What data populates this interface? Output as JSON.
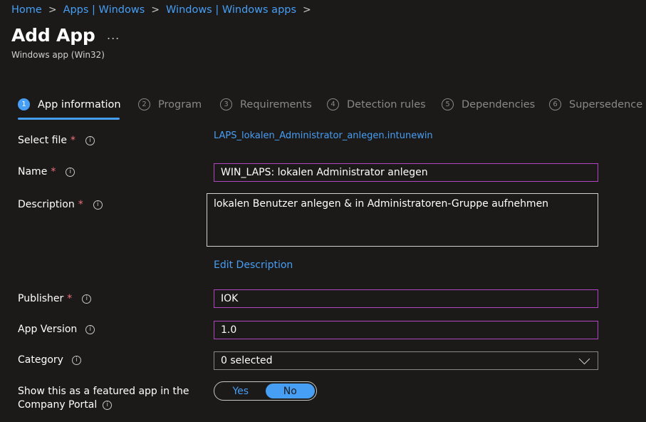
{
  "breadcrumb": {
    "items": [
      "Home",
      "Apps | Windows",
      "Windows | Windows apps"
    ],
    "separator": ">"
  },
  "header": {
    "title": "Add App",
    "more": "...",
    "subtitle": "Windows app (Win32)"
  },
  "steps": [
    {
      "num": "1",
      "label": "App information",
      "active": true
    },
    {
      "num": "2",
      "label": "Program"
    },
    {
      "num": "3",
      "label": "Requirements"
    },
    {
      "num": "4",
      "label": "Detection rules"
    },
    {
      "num": "5",
      "label": "Dependencies"
    },
    {
      "num": "6",
      "label": "Supersedence"
    }
  ],
  "form": {
    "select_file": {
      "label": "Select file",
      "required": "*",
      "value": "LAPS_lokalen_Administrator_anlegen.intunewin"
    },
    "name": {
      "label": "Name",
      "required": "*",
      "value": "WIN_LAPS: lokalen Administrator anlegen"
    },
    "description": {
      "label": "Description",
      "required": "*",
      "value": "lokalen Benutzer anlegen & in Administratoren-Gruppe aufnehmen",
      "edit_link": "Edit Description"
    },
    "publisher": {
      "label": "Publisher",
      "required": "*",
      "value": "IOK"
    },
    "app_version": {
      "label": "App Version",
      "value": "1.0"
    },
    "category": {
      "label": "Category",
      "value": "0 selected"
    },
    "featured": {
      "label_line1": "Show this as a featured app in the",
      "label_line2": "Company Portal",
      "yes": "Yes",
      "no": "No",
      "selected": "No"
    }
  },
  "icons": {
    "info": "i",
    "accent": "#479ef5",
    "required_color": "#f1707b",
    "focus_border": "#b146c2"
  }
}
